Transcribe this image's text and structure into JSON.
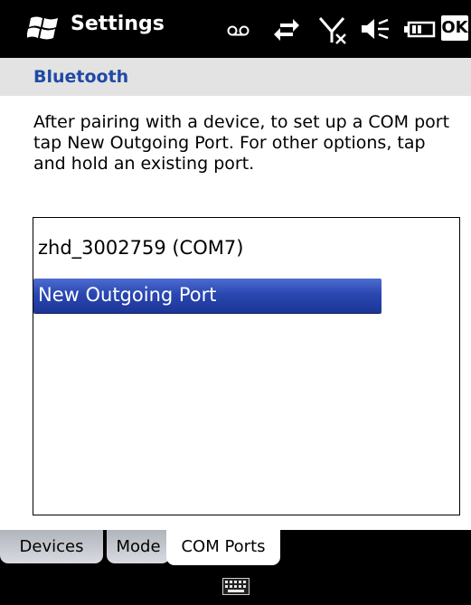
{
  "titlebar": {
    "title": "Settings",
    "ok_label": "OK",
    "icons": [
      "windows-start-icon",
      "voicemail-icon",
      "data-connection-icon",
      "no-signal-icon",
      "speaker-muted-icon",
      "battery-icon"
    ]
  },
  "header": {
    "title": "Bluetooth"
  },
  "description": "After pairing with a device, to set up a COM port tap New Outgoing Port. For other options, tap and hold an existing port.",
  "port_list": {
    "items": [
      {
        "label": "zhd_3002759 (COM7)",
        "selected": false
      },
      {
        "label": "New Outgoing Port",
        "selected": true
      }
    ]
  },
  "tabs": [
    {
      "label": "Devices",
      "active": false
    },
    {
      "label": "Mode",
      "active": false
    },
    {
      "label": "COM Ports",
      "active": true
    }
  ],
  "bottombar": {
    "icon": "keyboard-icon"
  },
  "colors": {
    "header_text": "#1f4aa5",
    "selection": "#2a47b2"
  }
}
